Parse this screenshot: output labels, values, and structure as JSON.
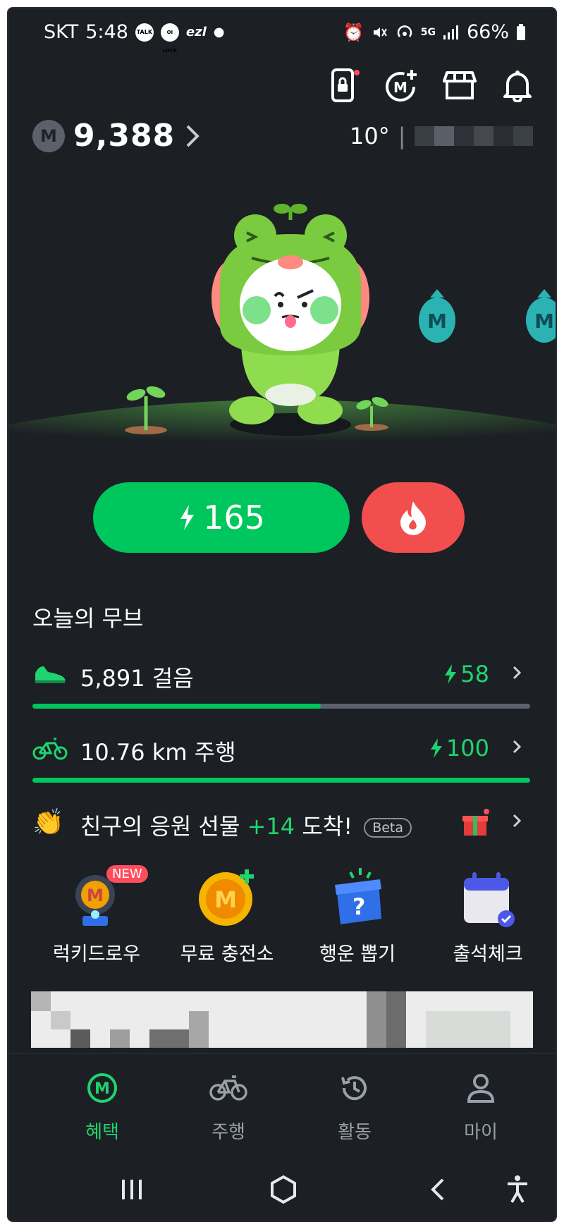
{
  "status_bar": {
    "carrier": "SKT",
    "time": "5:48",
    "badges": [
      "TALK",
      "OI LOCK",
      "ezl"
    ],
    "battery": "66%"
  },
  "top_icons": [
    "lock-screen-icon",
    "m-plus-icon",
    "store-icon",
    "bell-icon"
  ],
  "points": {
    "coin_letter": "M",
    "value": "9,388"
  },
  "weather": {
    "temperature": "10°"
  },
  "energy_button": {
    "value": "165"
  },
  "today": {
    "title": "오늘의 무브",
    "steps": {
      "label": "5,891 걸음",
      "reward": "58",
      "progress": 0.58
    },
    "ride": {
      "label": "10.76 km 주행",
      "reward": "100",
      "progress": 1.0
    },
    "friend_gift": {
      "text_before": "친구의 응원 선물 ",
      "highlight": "+14",
      "text_after": " 도착!",
      "beta": "Beta"
    }
  },
  "quick_menu": [
    {
      "label": "럭키드로우",
      "badge": "NEW",
      "coin": "M"
    },
    {
      "label": "무료 충전소",
      "coin": "M"
    },
    {
      "label": "행운 뽑기",
      "mark": "?"
    },
    {
      "label": "출석체크"
    }
  ],
  "tabs": [
    {
      "label": "혜택",
      "icon": "m-circle-icon",
      "active": true
    },
    {
      "label": "주행",
      "icon": "bicycle-icon"
    },
    {
      "label": "활동",
      "icon": "history-icon"
    },
    {
      "label": "마이",
      "icon": "person-icon"
    }
  ],
  "nav_buttons": [
    "recent-apps-icon",
    "home-icon",
    "back-icon",
    "accessibility-icon"
  ],
  "colors": {
    "accent": "#00c65e",
    "fire": "#f24e4e",
    "bg": "#1c1f24"
  },
  "character": {
    "badge_letter": "M"
  }
}
